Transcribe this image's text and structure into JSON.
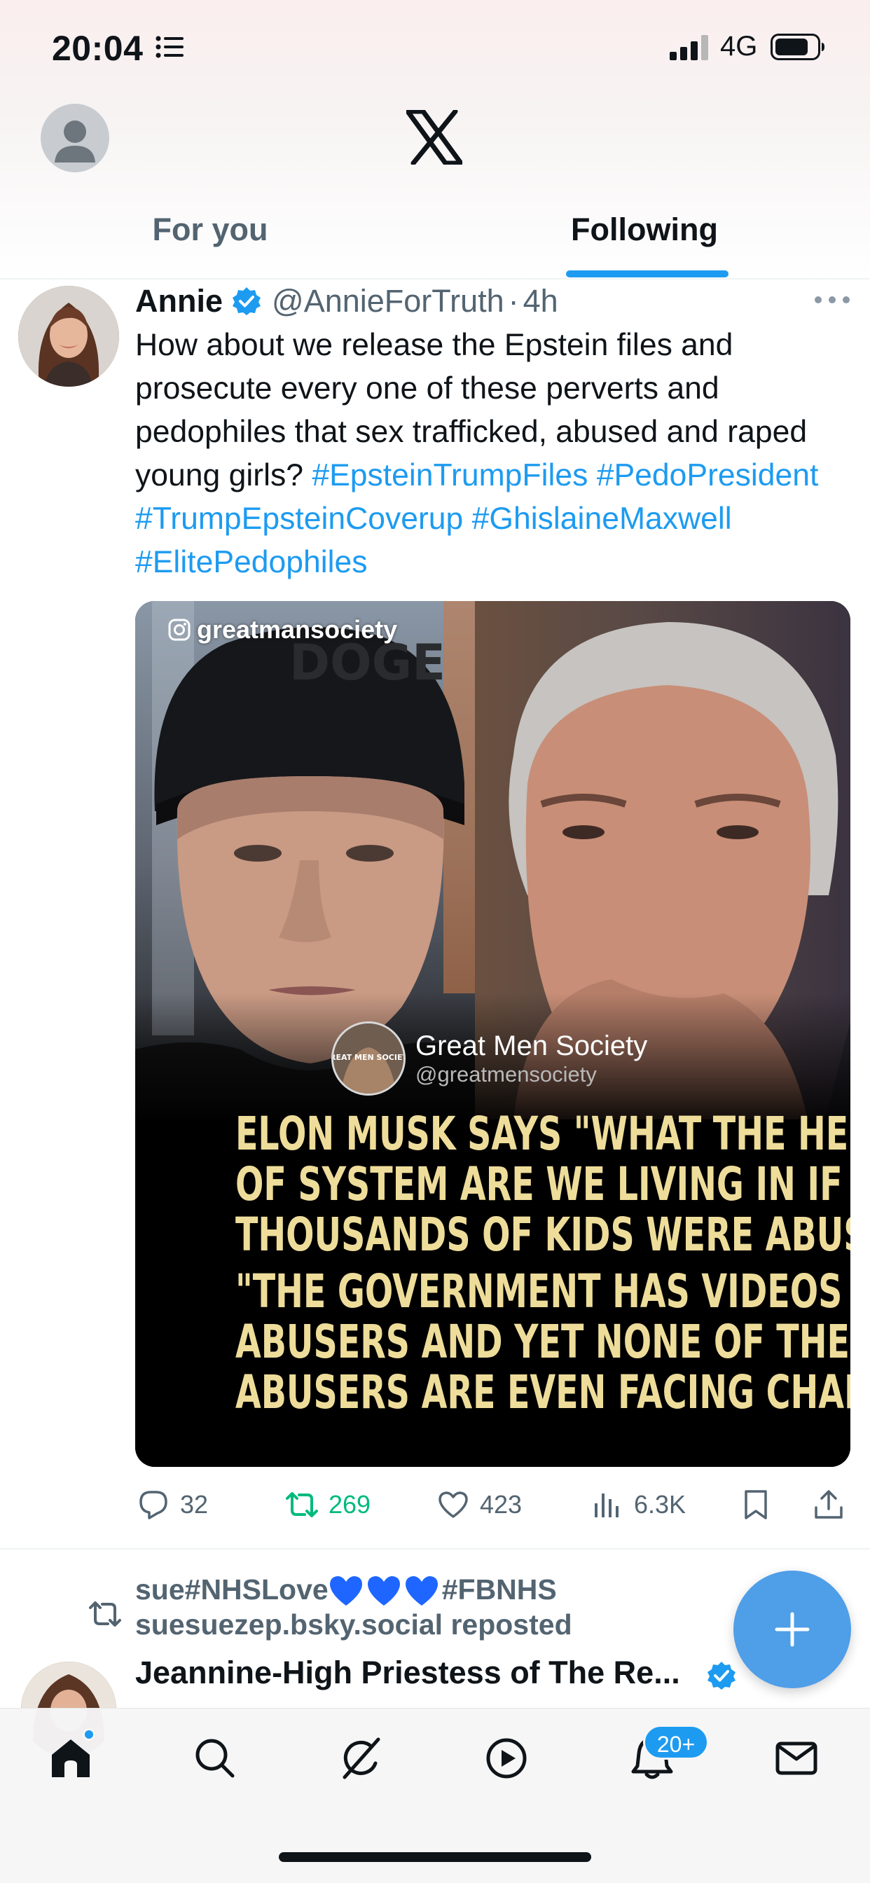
{
  "status_bar": {
    "time": "20:04",
    "network": "4G",
    "icons": [
      "list-icon",
      "signal-icon",
      "battery-icon"
    ]
  },
  "header": {
    "logo": "x-logo",
    "tabs": [
      {
        "label": "For you",
        "active": false
      },
      {
        "label": "Following",
        "active": true
      }
    ]
  },
  "tweet": {
    "author_name": "Annie",
    "verified": true,
    "handle": "@AnnieForTruth",
    "separator": "·",
    "time": "4h",
    "text_plain": "How about we release the Epstein files and prosecute every one of these perverts and pedophiles that sex trafficked, abused and raped young girls?",
    "hashtags": [
      "#EpsteinTrumpFiles",
      "#PedoPresident",
      "#TrumpEpsteinCoverup",
      "#GhislaineMaxwell",
      "#ElitePedophiles"
    ],
    "media": {
      "watermark": "greatmansociety",
      "source_name": "Great Men Society",
      "source_handle": "@greatmensociety",
      "avatar_text": "GREAT MEN SOCIETY",
      "caption_lines_1": [
        "ELON MUSK SAYS \"WHAT THE HELL KIND",
        "OF SYSTEM ARE WE LIVING IN IF",
        "THOUSANDS OF KIDS WERE ABUSED.\""
      ],
      "caption_lines_2": [
        "\"THE GOVERNMENT HAS VIDEOS OF THE",
        "ABUSERS AND YET NONE OF THE",
        "ABUSERS ARE EVEN FACING CHARGES!?\""
      ],
      "cap_text": "DOGE",
      "caption_color": "#eedd9a"
    },
    "actions": {
      "replies": "32",
      "reposts": "269",
      "likes": "423",
      "views": "6.3K"
    }
  },
  "next_tweet": {
    "repost_user": "sue#NHSLove",
    "repost_tag": "#FBNHS",
    "repost_line2": "suesuezep.bsky.social reposted",
    "author_name": "Jeannine-High Priestess of The Re...",
    "verified": true
  },
  "tabbar": {
    "items": [
      "home-icon",
      "search-icon",
      "grok-icon",
      "video-icon",
      "notifications-icon",
      "messages-icon"
    ],
    "notif_badge": "20+"
  },
  "colors": {
    "accent": "#1d9bf0",
    "repost_green": "#00ba7c",
    "muted": "#536471",
    "text": "#0f1419"
  }
}
